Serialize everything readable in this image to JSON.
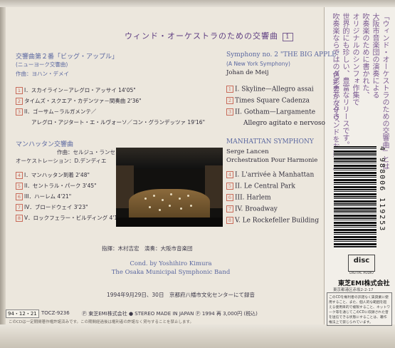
{
  "title": "ウィンド・オーケストラのための交響曲",
  "disc_number": "1",
  "left_section": {
    "heading": "交響曲第２番「ビッグ・アップル」",
    "subheading": "(ニューヨーク交響曲)",
    "composer": "作曲：ヨハン・デメイ",
    "tracks": [
      {
        "num": "1",
        "label": "I．スカイライン－アレグロ・アッサイ 14'05\""
      },
      {
        "num": "2",
        "label": "タイムズ・スクエア・カデンツァ－間奏曲 2'36\""
      },
      {
        "num": "3",
        "label": "II．ゴーサム－ラルガメンテ／"
      },
      {
        "num": "",
        "label": "アレグロ・アジタート・エ・ルヴォーソ／コン・グランデッツァ 19'16\""
      }
    ]
  },
  "right_section": {
    "heading": "Symphony no. 2 \"THE BIG APPLE\"",
    "subheading": "(A New York Symphony)",
    "composer": "Johan de Meij",
    "tracks": [
      {
        "num": "1",
        "label": "I. Skyline—Allegro assai"
      },
      {
        "num": "2",
        "label": "Times Square Cadenza"
      },
      {
        "num": "3",
        "label": "II. Gotham—Largamente"
      },
      {
        "num": "",
        "label": "Allegro agitato e nervoso"
      }
    ]
  },
  "left_section2": {
    "heading": "マンハッタン交響曲",
    "composer": "作曲：セルジュ・ランセン",
    "arranger": "オーケストレーション：D.デンディエ",
    "tracks": [
      {
        "num": "4",
        "label": "I．マンハッタン到着 2'48\""
      },
      {
        "num": "5",
        "label": "II．セントラル・パーク 3'45\""
      },
      {
        "num": "6",
        "label": "III．ハーレム 4'21\""
      },
      {
        "num": "7",
        "label": "IV．ブロードウェイ 3'23\""
      },
      {
        "num": "8",
        "label": "V．ロックフェラー・ビルディング 4'18\""
      }
    ]
  },
  "right_section2": {
    "heading": "MANHATTAN SYMPHONY",
    "composer": "Serge Lancen",
    "arranger": "Orchestration Pour Harmonie",
    "tracks": [
      {
        "num": "4",
        "label": "I. L'arrivée à Manhattan"
      },
      {
        "num": "5",
        "label": "II. Le Central Park"
      },
      {
        "num": "6",
        "label": "III. Harlem"
      },
      {
        "num": "7",
        "label": "IV. Broadway"
      },
      {
        "num": "8",
        "label": "V. Le Rockefeller Building"
      }
    ]
  },
  "credits": {
    "jp": "指揮：木村吉宏　演奏：大阪市音楽団",
    "en_line1": "Cond. by Yoshihiro Kimura",
    "en_line2": "The Osaka Municipal Symphonic Band",
    "recording": "1994年9月29日、30日　京都府八幡市文化センターにて録音"
  },
  "footer": {
    "date_sticker": "94・12・21",
    "catalog": "TOCZ-9236",
    "line": "Ⓟ 東芝EMI株式会社 ● STEREO MADE IN JAPAN Ⓟ 1994 再 3,000円 (税込)",
    "notice": "このCDは一定期間著作権許諾済みです。この期間経過後は権利者の許諾なく貸与することを禁止します。"
  },
  "spine": {
    "title": "「ウィンド・オーケストラのための交響曲」とは",
    "col1": "大阪市音楽団の演奏による",
    "col2": "吹奏楽のために書かれた、",
    "col3": "オリジナルのシンフォ作集で",
    "col4": "世界的にも珍しい、豊富なリリースです。",
    "col5": "吹奏楽ならではのダイナミックさ、",
    "col6": "色彩豊かなサウンドをお楽しみください。",
    "barcode_number": "4 988006 119253",
    "cd_logo": "disc",
    "cd_logo_sub": "DIGITAL AUDIO",
    "maker": "東芝EMI株式会社",
    "maker_address": "東京都港区赤坂2-2-17",
    "notice": "このCDを権利者の許諾なく賃貸業に使用すること、また、個人的な範囲を超える使用目的で複製すること、ネットワーク等を通じてこのCDに収録された音を送信できる状態にすることは、著作権法上で禁じられています。"
  },
  "colors": {
    "accent_purple": "#5f3e82",
    "heading_blue": "#5a67a0",
    "track_num_red": "#c86b5a"
  }
}
